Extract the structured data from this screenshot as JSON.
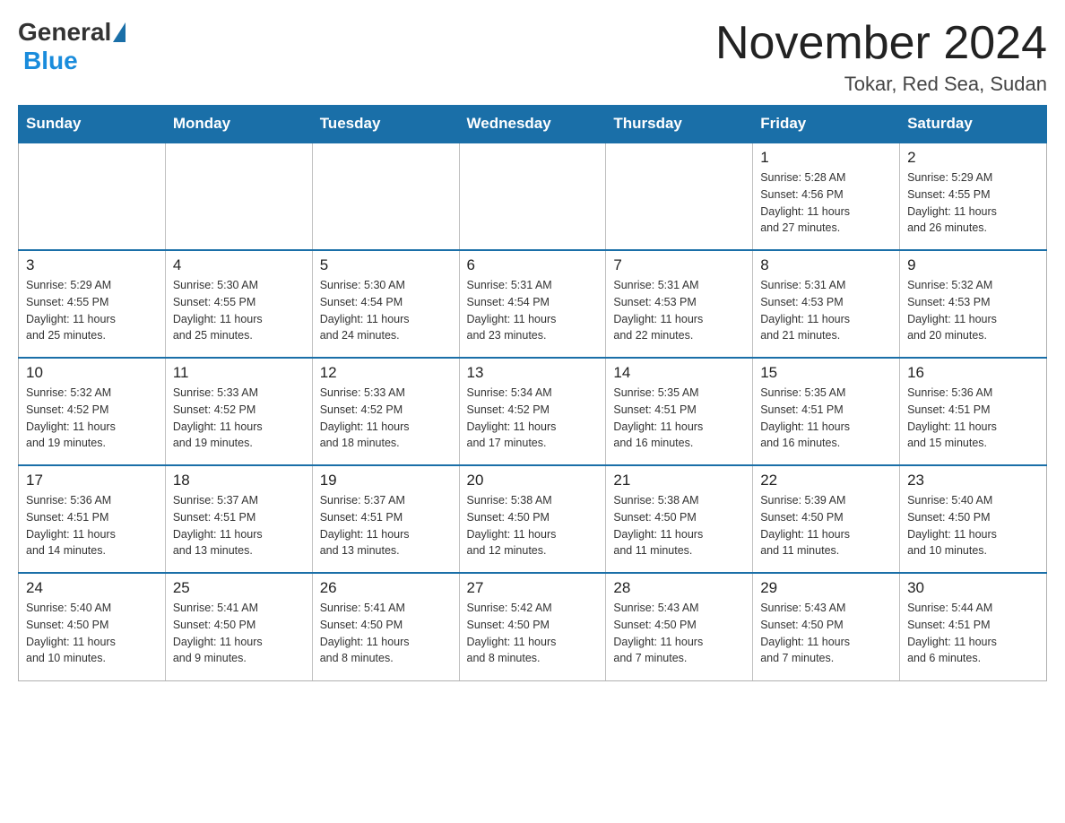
{
  "header": {
    "logo_general": "General",
    "logo_blue": "Blue",
    "month_title": "November 2024",
    "location": "Tokar, Red Sea, Sudan"
  },
  "days_of_week": [
    "Sunday",
    "Monday",
    "Tuesday",
    "Wednesday",
    "Thursday",
    "Friday",
    "Saturday"
  ],
  "weeks": [
    [
      {
        "day": "",
        "info": ""
      },
      {
        "day": "",
        "info": ""
      },
      {
        "day": "",
        "info": ""
      },
      {
        "day": "",
        "info": ""
      },
      {
        "day": "",
        "info": ""
      },
      {
        "day": "1",
        "info": "Sunrise: 5:28 AM\nSunset: 4:56 PM\nDaylight: 11 hours\nand 27 minutes."
      },
      {
        "day": "2",
        "info": "Sunrise: 5:29 AM\nSunset: 4:55 PM\nDaylight: 11 hours\nand 26 minutes."
      }
    ],
    [
      {
        "day": "3",
        "info": "Sunrise: 5:29 AM\nSunset: 4:55 PM\nDaylight: 11 hours\nand 25 minutes."
      },
      {
        "day": "4",
        "info": "Sunrise: 5:30 AM\nSunset: 4:55 PM\nDaylight: 11 hours\nand 25 minutes."
      },
      {
        "day": "5",
        "info": "Sunrise: 5:30 AM\nSunset: 4:54 PM\nDaylight: 11 hours\nand 24 minutes."
      },
      {
        "day": "6",
        "info": "Sunrise: 5:31 AM\nSunset: 4:54 PM\nDaylight: 11 hours\nand 23 minutes."
      },
      {
        "day": "7",
        "info": "Sunrise: 5:31 AM\nSunset: 4:53 PM\nDaylight: 11 hours\nand 22 minutes."
      },
      {
        "day": "8",
        "info": "Sunrise: 5:31 AM\nSunset: 4:53 PM\nDaylight: 11 hours\nand 21 minutes."
      },
      {
        "day": "9",
        "info": "Sunrise: 5:32 AM\nSunset: 4:53 PM\nDaylight: 11 hours\nand 20 minutes."
      }
    ],
    [
      {
        "day": "10",
        "info": "Sunrise: 5:32 AM\nSunset: 4:52 PM\nDaylight: 11 hours\nand 19 minutes."
      },
      {
        "day": "11",
        "info": "Sunrise: 5:33 AM\nSunset: 4:52 PM\nDaylight: 11 hours\nand 19 minutes."
      },
      {
        "day": "12",
        "info": "Sunrise: 5:33 AM\nSunset: 4:52 PM\nDaylight: 11 hours\nand 18 minutes."
      },
      {
        "day": "13",
        "info": "Sunrise: 5:34 AM\nSunset: 4:52 PM\nDaylight: 11 hours\nand 17 minutes."
      },
      {
        "day": "14",
        "info": "Sunrise: 5:35 AM\nSunset: 4:51 PM\nDaylight: 11 hours\nand 16 minutes."
      },
      {
        "day": "15",
        "info": "Sunrise: 5:35 AM\nSunset: 4:51 PM\nDaylight: 11 hours\nand 16 minutes."
      },
      {
        "day": "16",
        "info": "Sunrise: 5:36 AM\nSunset: 4:51 PM\nDaylight: 11 hours\nand 15 minutes."
      }
    ],
    [
      {
        "day": "17",
        "info": "Sunrise: 5:36 AM\nSunset: 4:51 PM\nDaylight: 11 hours\nand 14 minutes."
      },
      {
        "day": "18",
        "info": "Sunrise: 5:37 AM\nSunset: 4:51 PM\nDaylight: 11 hours\nand 13 minutes."
      },
      {
        "day": "19",
        "info": "Sunrise: 5:37 AM\nSunset: 4:51 PM\nDaylight: 11 hours\nand 13 minutes."
      },
      {
        "day": "20",
        "info": "Sunrise: 5:38 AM\nSunset: 4:50 PM\nDaylight: 11 hours\nand 12 minutes."
      },
      {
        "day": "21",
        "info": "Sunrise: 5:38 AM\nSunset: 4:50 PM\nDaylight: 11 hours\nand 11 minutes."
      },
      {
        "day": "22",
        "info": "Sunrise: 5:39 AM\nSunset: 4:50 PM\nDaylight: 11 hours\nand 11 minutes."
      },
      {
        "day": "23",
        "info": "Sunrise: 5:40 AM\nSunset: 4:50 PM\nDaylight: 11 hours\nand 10 minutes."
      }
    ],
    [
      {
        "day": "24",
        "info": "Sunrise: 5:40 AM\nSunset: 4:50 PM\nDaylight: 11 hours\nand 10 minutes."
      },
      {
        "day": "25",
        "info": "Sunrise: 5:41 AM\nSunset: 4:50 PM\nDaylight: 11 hours\nand 9 minutes."
      },
      {
        "day": "26",
        "info": "Sunrise: 5:41 AM\nSunset: 4:50 PM\nDaylight: 11 hours\nand 8 minutes."
      },
      {
        "day": "27",
        "info": "Sunrise: 5:42 AM\nSunset: 4:50 PM\nDaylight: 11 hours\nand 8 minutes."
      },
      {
        "day": "28",
        "info": "Sunrise: 5:43 AM\nSunset: 4:50 PM\nDaylight: 11 hours\nand 7 minutes."
      },
      {
        "day": "29",
        "info": "Sunrise: 5:43 AM\nSunset: 4:50 PM\nDaylight: 11 hours\nand 7 minutes."
      },
      {
        "day": "30",
        "info": "Sunrise: 5:44 AM\nSunset: 4:51 PM\nDaylight: 11 hours\nand 6 minutes."
      }
    ]
  ]
}
